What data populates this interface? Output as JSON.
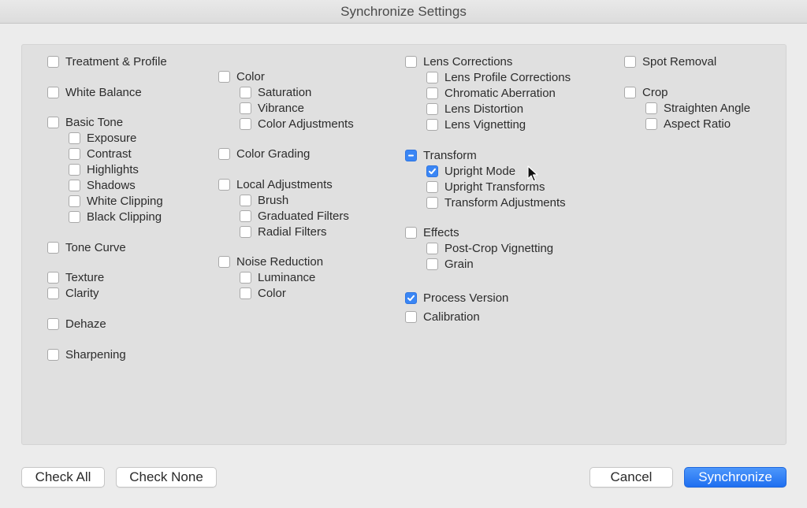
{
  "window": {
    "title": "Synchronize Settings"
  },
  "settings": {
    "treatment_profile": {
      "label": "Treatment & Profile",
      "state": "unchecked"
    },
    "white_balance": {
      "label": "White Balance",
      "state": "unchecked"
    },
    "basic_tone": {
      "label": "Basic Tone",
      "state": "unchecked"
    },
    "exposure": {
      "label": "Exposure",
      "state": "unchecked"
    },
    "contrast": {
      "label": "Contrast",
      "state": "unchecked"
    },
    "highlights": {
      "label": "Highlights",
      "state": "unchecked"
    },
    "shadows": {
      "label": "Shadows",
      "state": "unchecked"
    },
    "white_clipping": {
      "label": "White Clipping",
      "state": "unchecked"
    },
    "black_clipping": {
      "label": "Black Clipping",
      "state": "unchecked"
    },
    "tone_curve": {
      "label": "Tone Curve",
      "state": "unchecked"
    },
    "texture": {
      "label": "Texture",
      "state": "unchecked"
    },
    "clarity": {
      "label": "Clarity",
      "state": "unchecked"
    },
    "dehaze": {
      "label": "Dehaze",
      "state": "unchecked"
    },
    "sharpening": {
      "label": "Sharpening",
      "state": "unchecked"
    },
    "color": {
      "label": "Color",
      "state": "unchecked"
    },
    "saturation": {
      "label": "Saturation",
      "state": "unchecked"
    },
    "vibrance": {
      "label": "Vibrance",
      "state": "unchecked"
    },
    "color_adjustments": {
      "label": "Color Adjustments",
      "state": "unchecked"
    },
    "color_grading": {
      "label": "Color Grading",
      "state": "unchecked"
    },
    "local_adjustments": {
      "label": "Local Adjustments",
      "state": "unchecked"
    },
    "brush": {
      "label": "Brush",
      "state": "unchecked"
    },
    "graduated_filters": {
      "label": "Graduated Filters",
      "state": "unchecked"
    },
    "radial_filters": {
      "label": "Radial Filters",
      "state": "unchecked"
    },
    "noise_reduction": {
      "label": "Noise Reduction",
      "state": "unchecked"
    },
    "luminance": {
      "label": "Luminance",
      "state": "unchecked"
    },
    "noise_color": {
      "label": "Color",
      "state": "unchecked"
    },
    "lens_corrections": {
      "label": "Lens Corrections",
      "state": "unchecked"
    },
    "lens_profile_corrections": {
      "label": "Lens Profile Corrections",
      "state": "unchecked"
    },
    "chromatic_aberration": {
      "label": "Chromatic Aberration",
      "state": "unchecked"
    },
    "lens_distortion": {
      "label": "Lens Distortion",
      "state": "unchecked"
    },
    "lens_vignetting": {
      "label": "Lens Vignetting",
      "state": "unchecked"
    },
    "transform": {
      "label": "Transform",
      "state": "mixed"
    },
    "upright_mode": {
      "label": "Upright Mode",
      "state": "checked"
    },
    "upright_transforms": {
      "label": "Upright Transforms",
      "state": "unchecked"
    },
    "transform_adjustments": {
      "label": "Transform Adjustments",
      "state": "unchecked"
    },
    "effects": {
      "label": "Effects",
      "state": "unchecked"
    },
    "post_crop_vignetting": {
      "label": "Post-Crop Vignetting",
      "state": "unchecked"
    },
    "grain": {
      "label": "Grain",
      "state": "unchecked"
    },
    "process_version": {
      "label": "Process Version",
      "state": "checked"
    },
    "calibration": {
      "label": "Calibration",
      "state": "unchecked"
    },
    "spot_removal": {
      "label": "Spot Removal",
      "state": "unchecked"
    },
    "crop": {
      "label": "Crop",
      "state": "unchecked"
    },
    "straighten_angle": {
      "label": "Straighten Angle",
      "state": "unchecked"
    },
    "aspect_ratio": {
      "label": "Aspect Ratio",
      "state": "unchecked"
    }
  },
  "buttons": {
    "check_all": "Check All",
    "check_none": "Check None",
    "cancel": "Cancel",
    "synchronize": "Synchronize"
  },
  "colors": {
    "accent": "#3a86f5",
    "window_bg": "#ececec",
    "panel_bg": "#e0e0e0"
  },
  "icons": {
    "check": "checkmark-icon",
    "mixed": "dash-icon",
    "cursor": "arrow-cursor-icon"
  }
}
